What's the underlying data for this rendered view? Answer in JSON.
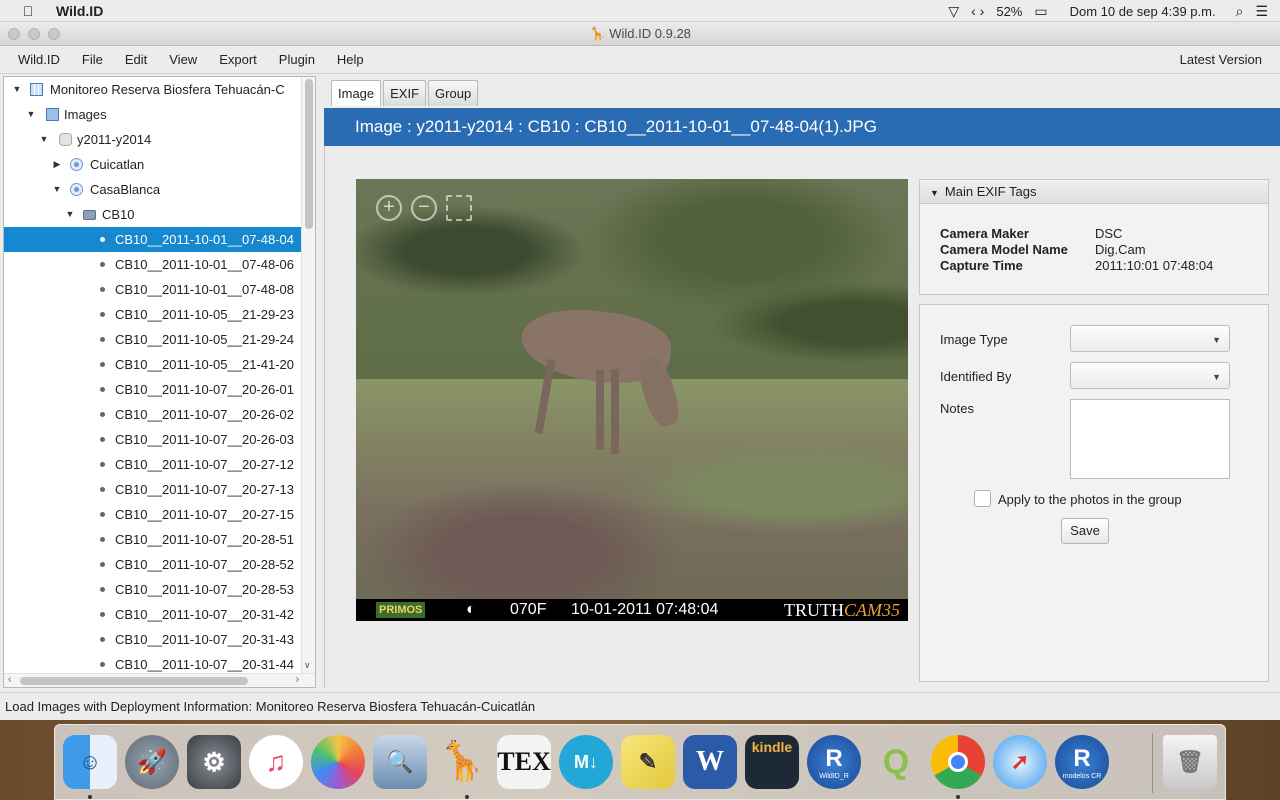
{
  "menubar": {
    "app_name": "Wild.ID",
    "battery": "52%",
    "datetime": "Dom 10 de sep  4:39 p.m."
  },
  "window": {
    "title": "Wild.ID 0.9.28"
  },
  "app_menu": {
    "items": [
      "Wild.ID",
      "File",
      "Edit",
      "View",
      "Export",
      "Plugin",
      "Help"
    ],
    "latest_version": "Latest Version"
  },
  "tree": {
    "project": "Monitoreo Reserva Biosfera Tehuacán-C",
    "images": "Images",
    "group": "y2011-y2014",
    "site1": "Cuicatlan",
    "site2": "CasaBlanca",
    "camera": "CB10",
    "files": [
      "CB10__2011-10-01__07-48-04",
      "CB10__2011-10-01__07-48-06",
      "CB10__2011-10-01__07-48-08",
      "CB10__2011-10-05__21-29-23",
      "CB10__2011-10-05__21-29-24",
      "CB10__2011-10-05__21-41-20",
      "CB10__2011-10-07__20-26-01",
      "CB10__2011-10-07__20-26-02",
      "CB10__2011-10-07__20-26-03",
      "CB10__2011-10-07__20-27-12",
      "CB10__2011-10-07__20-27-13",
      "CB10__2011-10-07__20-27-15",
      "CB10__2011-10-07__20-28-51",
      "CB10__2011-10-07__20-28-52",
      "CB10__2011-10-07__20-28-53",
      "CB10__2011-10-07__20-31-42",
      "CB10__2011-10-07__20-31-43",
      "CB10__2011-10-07__20-31-44"
    ]
  },
  "tabs": [
    "Image",
    "EXIF",
    "Group"
  ],
  "banner": "Image : y2011-y2014 : CB10 : CB10__2011-10-01__07-48-04(1).JPG",
  "photo_overlay": {
    "brand": "PRIMOS",
    "temp": "070F",
    "datetime": "10-01-2011  07:48:04",
    "cam_word": "TRUTH",
    "cam_model": "CAM",
    "cam_num": "35"
  },
  "exif": {
    "header": "Main EXIF Tags",
    "rows": [
      {
        "key": "Camera Maker",
        "value": "DSC"
      },
      {
        "key": "Camera Model Name",
        "value": "Dig.Cam"
      },
      {
        "key": "Capture Time",
        "value": "2011:10:01 07:48:04"
      }
    ]
  },
  "form": {
    "image_type_label": "Image Type",
    "identified_by_label": "Identified By",
    "notes_label": "Notes",
    "apply_label": "Apply to the photos in the group",
    "save_label": "Save"
  },
  "statusbar": "Load Images with Deployment Information: Monitoreo Reserva Biosfera Tehuacán-Cuicatlán",
  "dock": {
    "tex_label": "TEX",
    "markdown_label": "M↓",
    "word_label": "W",
    "kindle_label": "kindle",
    "r1_label": "R",
    "r1_caption": "WildID_R",
    "r2_label": "R",
    "r2_caption": "modelos CR"
  }
}
